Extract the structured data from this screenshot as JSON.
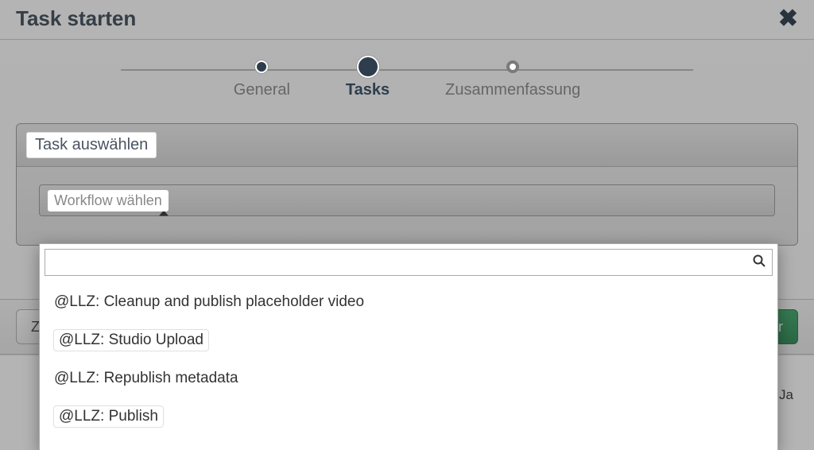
{
  "modal": {
    "title": "Task starten",
    "close_icon": "×"
  },
  "stepper": {
    "steps": [
      {
        "label": "General",
        "state": "done"
      },
      {
        "label": "Tasks",
        "state": "active"
      },
      {
        "label": "Zusammenfassung",
        "state": "future"
      }
    ]
  },
  "panel": {
    "header": "Task auswählen",
    "select_label": "Workflow wählen"
  },
  "dropdown": {
    "search_value": "",
    "items": [
      "@LLZ: Cleanup and publish placeholder video",
      "@LLZ: Studio Upload",
      "@LLZ: Republish metadata",
      "@LLZ: Publish"
    ]
  },
  "footer": {
    "back_label_partial": "Z",
    "next_label_partial": "er"
  },
  "table_bg": {
    "right_cell": "Ja"
  }
}
